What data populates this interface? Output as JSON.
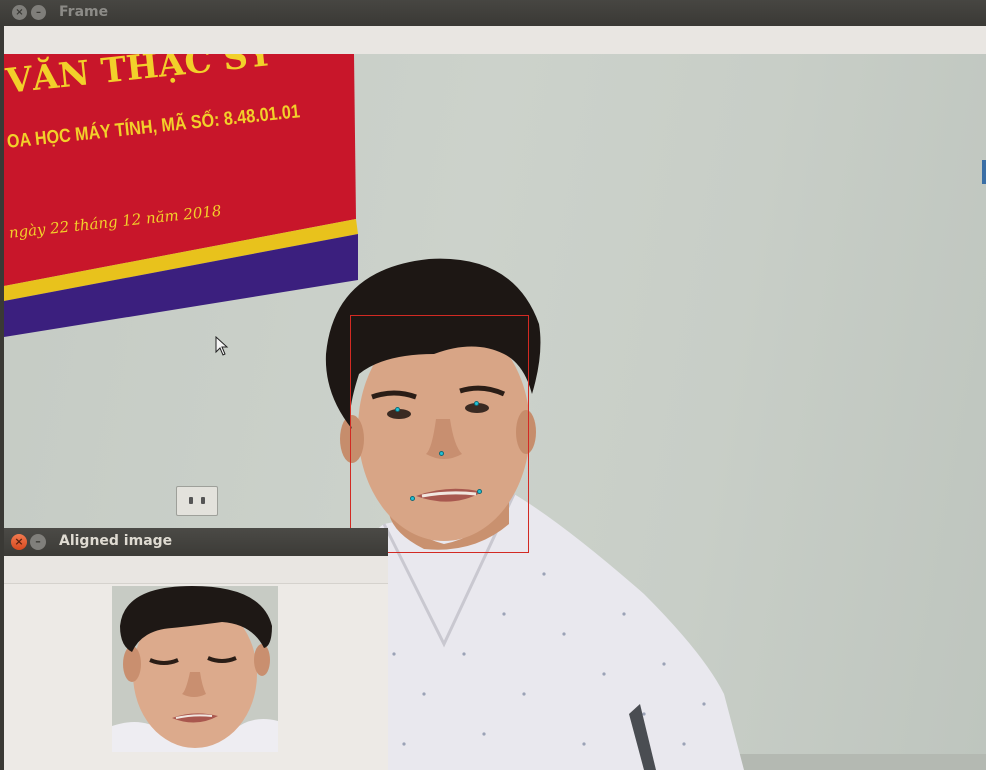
{
  "main_window": {
    "title": "Frame",
    "close_glyph": "×",
    "minimize_glyph": "–"
  },
  "camera": {
    "banner": {
      "line1": "VĂN THẠC SỸ",
      "line2": "OA HỌC MÁY TÍNH, MÃ SỐ: 8.48.01.01",
      "line3": "ngày 22 tháng 12 năm 2018"
    },
    "overlay": {
      "face_box_color": "#d22a23",
      "landmark_color": "#22c2d6"
    }
  },
  "aligned_window": {
    "title": "Aligned image",
    "close_glyph": "×",
    "minimize_glyph": "–"
  },
  "icons": [
    "close-icon",
    "minimize-icon",
    "mouse-pointer-icon"
  ]
}
